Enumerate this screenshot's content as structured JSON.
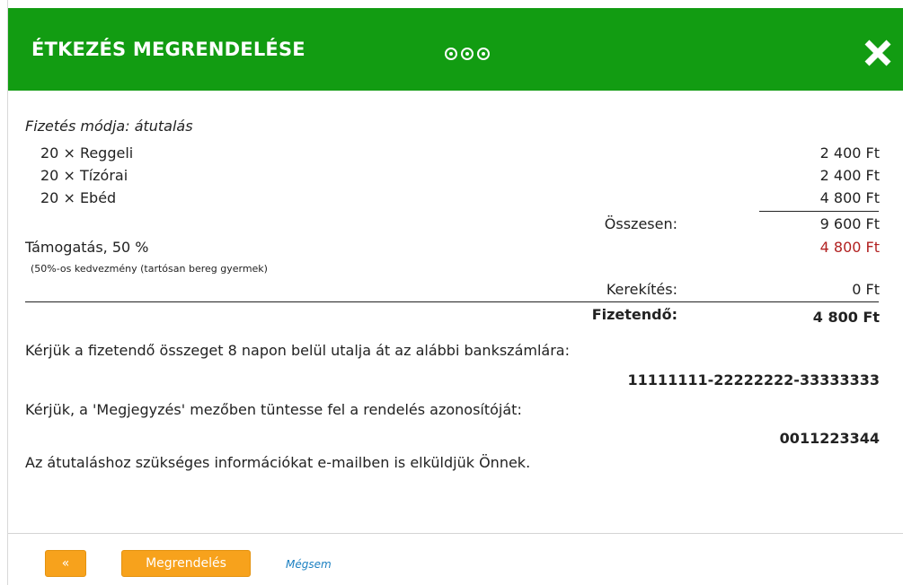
{
  "header": {
    "title": "ÉTKEZÉS MEGRENDELÉSE",
    "close_icon": "close-icon",
    "colors": {
      "background": "#129c12",
      "text": "#ffffff"
    }
  },
  "payment": {
    "method": "Fizetés módja: átutalás",
    "items": [
      {
        "label": "20 × Reggeli",
        "amount": "2 400 Ft"
      },
      {
        "label": "20 × Tízórai",
        "amount": "2 400 Ft"
      },
      {
        "label": "20 × Ebéd",
        "amount": "4 800 Ft"
      }
    ],
    "total_label": "Összesen:",
    "total_amount": "9 600 Ft",
    "subsidy_label": "Támogatás, 50 %",
    "subsidy_amount": "4 800 Ft",
    "subsidy_note": "(50%-os kedvezmény (tartósan bereg gyermek)",
    "rounding_label": "Kerekítés:",
    "rounding_amount": "0 Ft",
    "payable_label": "Fizetendő:",
    "payable_amount": "4 800 Ft",
    "subsidy_color": "#b22222"
  },
  "instructions": {
    "transfer_text": "Kérjük a fizetendő összeget 8 napon belül utalja át az alábbi bankszámlára:",
    "bank_account": "11111111-22222222-33333333",
    "reference_text": "Kérjük, a 'Megjegyzés' mezőben tüntesse fel a rendelés azonosítóját:",
    "order_id": "0011223344",
    "email_text": "Az átutaláshoz szükséges információkat e-mailben is elküldjük Önnek."
  },
  "footer": {
    "back_label": "«",
    "order_label": "Megrendelés",
    "cancel_label": "Mégsem",
    "button_color": "#f7a21c",
    "link_color": "#1a7fc1"
  }
}
